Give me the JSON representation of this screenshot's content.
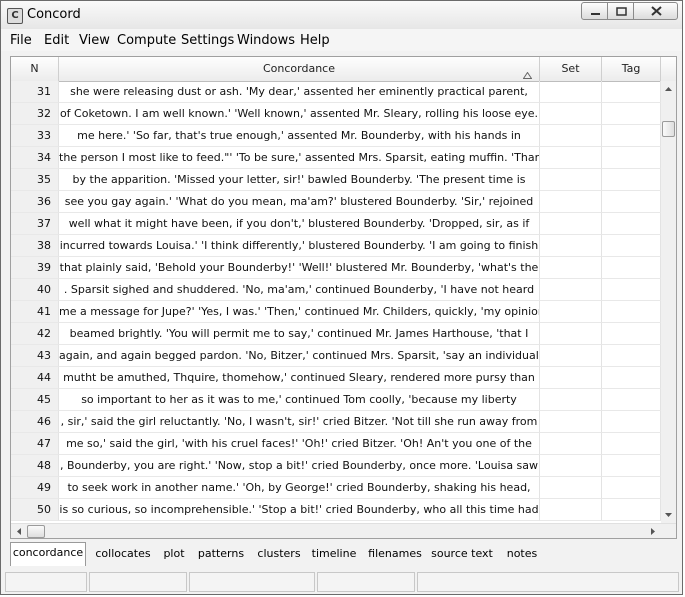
{
  "window": {
    "title": "Concord"
  },
  "menu": [
    "File",
    "Edit",
    "View",
    "Compute",
    "Settings",
    "Windows",
    "Help"
  ],
  "columns": {
    "n": "N",
    "concordance": "Concordance",
    "set": "Set",
    "tag": "Tag"
  },
  "rows": [
    {
      "n": "31",
      "text": "she were releasing dust or ash. 'My dear,' assented her eminently practical parent,"
    },
    {
      "n": "32",
      "text": "of Coketown. I am well known.' 'Well known,' assented Mr. Sleary, rolling his loose eye."
    },
    {
      "n": "33",
      "text": "me here.' 'So far, that's true enough,' assented Mr. Bounderby, with his hands in"
    },
    {
      "n": "34",
      "text": "the person I most like to feed.\"' 'To be sure,' assented Mrs. Sparsit, eating muffin. 'Thank"
    },
    {
      "n": "35",
      "text": "by the apparition. 'Missed your letter, sir!' bawled Bounderby. 'The present time is"
    },
    {
      "n": "36",
      "text": "see you gay again.' 'What do you mean, ma'am?' blustered Bounderby. 'Sir,' rejoined"
    },
    {
      "n": "37",
      "text": "well what it might have been, if you don't,' blustered Bounderby. 'Dropped, sir, as if"
    },
    {
      "n": "38",
      "text": "incurred towards Louisa.' 'I think differently,' blustered Bounderby. 'I am going to finish"
    },
    {
      "n": "39",
      "text": "that plainly said, 'Behold your Bounderby!' 'Well!' blustered Mr. Bounderby, 'what's the"
    },
    {
      "n": "40",
      "text": ". Sparsit sighed and shuddered. 'No, ma'am,' continued Bounderby, 'I have not heard"
    },
    {
      "n": "41",
      "text": "me a message for Jupe?' 'Yes, I was.' 'Then,' continued Mr. Childers, quickly, 'my opinion"
    },
    {
      "n": "42",
      "text": "beamed brightly. 'You will permit me to say,' continued Mr. James Harthouse, 'that I"
    },
    {
      "n": "43",
      "text": "again, and again begged pardon. 'No, Bitzer,' continued Mrs. Sparsit, 'say an individual,"
    },
    {
      "n": "44",
      "text": "mutht be amuthed, Thquire, thomehow,' continued Sleary, rendered more pursy than"
    },
    {
      "n": "45",
      "text": "so important to her as it was to me,' continued Tom coolly, 'because my liberty"
    },
    {
      "n": "46",
      "text": ", sir,' said the girl reluctantly. 'No, I wasn't, sir!' cried Bitzer. 'Not till she run away from"
    },
    {
      "n": "47",
      "text": "me so,' said the girl, 'with his cruel faces!' 'Oh!' cried Bitzer. 'Oh! An't you one of the"
    },
    {
      "n": "48",
      "text": ", Bounderby, you are right.' 'Now, stop a bit!' cried Bounderby, once more. 'Louisa saw"
    },
    {
      "n": "49",
      "text": "to seek work in another name.' 'Oh, by George!' cried Bounderby, shaking his head,"
    },
    {
      "n": "50",
      "text": "is so curious, so incomprehensible.' 'Stop a bit!' cried Bounderby, who all this time had"
    }
  ],
  "tabs": [
    "concordance",
    "collocates",
    "plot",
    "patterns",
    "clusters",
    "timeline",
    "filenames",
    "source text",
    "notes"
  ],
  "active_tab": "concordance"
}
